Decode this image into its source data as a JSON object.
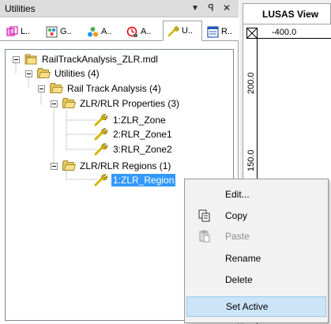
{
  "panel": {
    "title": "Utilities",
    "controls": {
      "dropdown": "▼",
      "pin": "ꟼ",
      "close": "✕"
    },
    "tabs": [
      {
        "label": "L..",
        "icon": "geometry-icon",
        "active": false
      },
      {
        "label": "G..",
        "icon": "groups-icon",
        "active": false
      },
      {
        "label": "A..",
        "icon": "attributes-icon",
        "active": false
      },
      {
        "label": "A..",
        "icon": "analyses-icon",
        "active": false
      },
      {
        "label": "U..",
        "icon": "utilities-wrench-icon",
        "active": true
      },
      {
        "label": "R..",
        "icon": "reports-icon",
        "active": false
      }
    ]
  },
  "tree": {
    "root": "RailTrackAnalysis_ZLR.mdl",
    "utilities": "Utilities (4)",
    "rail_track": "Rail Track Analysis (4)",
    "properties_folder": "ZLR/RLR Properties (3)",
    "properties": [
      "1:ZLR_Zone",
      "2:RLR_Zone1",
      "3:RLR_Zone2"
    ],
    "regions_folder": "ZLR/RLR Regions (1)",
    "regions": [
      "1:ZLR_Region"
    ]
  },
  "view": {
    "tab_title": "LUSAS View",
    "ruler_x_label": "-400.0",
    "ruler_y_labels": [
      "200.0",
      "150.0"
    ]
  },
  "context_menu": {
    "items": [
      {
        "label": "Edit...",
        "icon": "",
        "enabled": true,
        "highlighted": false
      },
      {
        "label": "Copy",
        "icon": "copy-icon",
        "enabled": true,
        "highlighted": false
      },
      {
        "label": "Paste",
        "icon": "paste-icon",
        "enabled": false,
        "highlighted": false
      },
      {
        "label": "Rename",
        "icon": "",
        "enabled": true,
        "highlighted": false
      },
      {
        "label": "Delete",
        "icon": "",
        "enabled": true,
        "highlighted": false
      },
      {
        "label": "Set Active",
        "icon": "",
        "enabled": true,
        "highlighted": true
      }
    ]
  },
  "colors": {
    "selection": "#3399ff",
    "menu_highlight": "#cce4f7",
    "folder": "#e8c95c",
    "wrench": "#d4b400"
  }
}
